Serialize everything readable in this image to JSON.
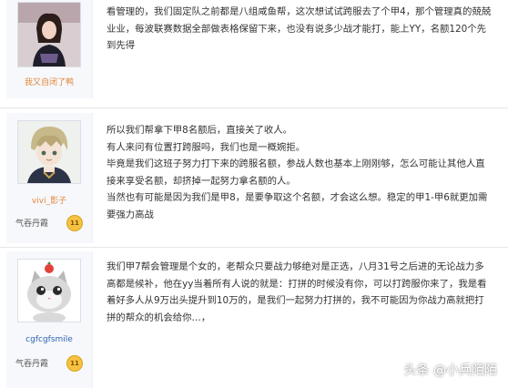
{
  "posts": [
    {
      "username": "我又自闭了鸭",
      "badge": null,
      "lines": [
        "看管理的，我们固定队之前都是八组咸鱼帮，这次想试试跨服去了个甲4，那个管理真的兢兢",
        "业业，每波联赛数据全部做表格保留下来，也没有说多少战才能打，能上YY，名额120个先",
        "到先得"
      ]
    },
    {
      "username": "vivi_影子",
      "badge": {
        "label": "气吞丹霞",
        "level": "11"
      },
      "lines": [
        "所以我们帮拿下甲8名额后，直接关了收人。",
        "有人来问有位置打跨服吗，我们也是一概婉拒。",
        "毕竟是我们这班子努力打下来的跨服名额，参战人数也基本上刚刚够，怎么可能让其他人直",
        "接来享受名额，却挤掉一起努力拿名额的人。",
        "当然也有可能是因为我们是甲8，是要争取这个名额，才会这么想。稳定的甲1-甲6就更加需",
        "要强力高战"
      ]
    },
    {
      "username": "cgfcgfsmile",
      "badge": {
        "label": "气吞丹霞",
        "level": "11"
      },
      "lines": [
        "我们甲7帮会管理是个女的，老帮众只要战力够绝对是正选，八月31号之后进的无论战力多",
        "高都是候补，他在yy当着所有人说的就是：打拼的时候没有你，可以打跨服你来了，我是看",
        "着好多人从9万出头提升到10万的，是我们一起努力打拼的，我不可能因为你战力高就把打",
        "拼的帮众的机会给你…，"
      ]
    }
  ],
  "watermark": "头条 @小兵陌陌",
  "colors": {
    "link": "#2d64b3",
    "sidebar": "#f6f8fb",
    "badge": "#f5c241"
  }
}
